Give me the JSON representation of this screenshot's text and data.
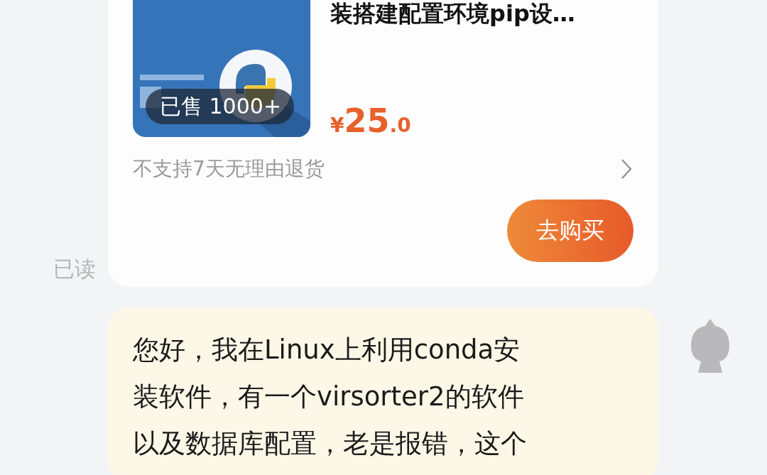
{
  "product": {
    "sold_badge": "已售 1000+",
    "title": "装搭建配置环境pip设…",
    "price": {
      "currency": "¥",
      "integer": "25",
      "decimal": ".0"
    },
    "return_policy": "不支持7天无理由退货",
    "buy_button": "去购买"
  },
  "read_status": "已读",
  "message": {
    "lines": [
      "您好，我在Linux上利用conda安",
      "装软件，有一个virsorter2的软件",
      "以及数据库配置，老是报错，这个"
    ]
  }
}
